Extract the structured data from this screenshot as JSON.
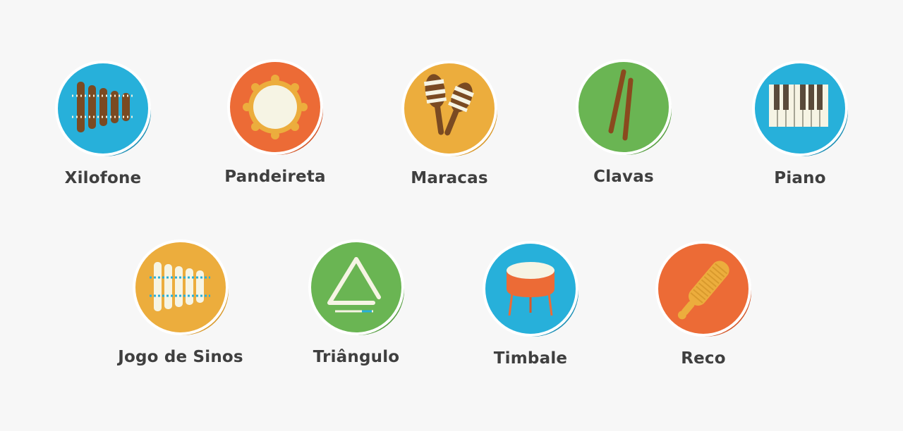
{
  "instruments": [
    {
      "id": "xilofone",
      "label": "Xilofone",
      "color": "#27b0da",
      "shadow": "#1d90b6",
      "icon": "xylophone-icon"
    },
    {
      "id": "pandeireta",
      "label": "Pandeireta",
      "color": "#ec6b36",
      "shadow": "#d4582a",
      "icon": "tambourine-icon"
    },
    {
      "id": "maracas",
      "label": "Maracas",
      "color": "#ecad3d",
      "shadow": "#d99a2d",
      "icon": "maracas-icon"
    },
    {
      "id": "clavas",
      "label": "Clavas",
      "color": "#6ab553",
      "shadow": "#58a043",
      "icon": "claves-icon"
    },
    {
      "id": "piano",
      "label": "Piano",
      "color": "#27b0da",
      "shadow": "#1d90b6",
      "icon": "piano-icon"
    },
    {
      "id": "jogo-de-sinos",
      "label": "Jogo de Sinos",
      "color": "#ecad3d",
      "shadow": "#d99a2d",
      "icon": "glockenspiel-icon"
    },
    {
      "id": "triangulo",
      "label": "Triângulo",
      "color": "#6ab553",
      "shadow": "#58a043",
      "icon": "triangle-icon"
    },
    {
      "id": "timbale",
      "label": "Timbale",
      "color": "#27b0da",
      "shadow": "#1d90b6",
      "icon": "timbale-icon"
    },
    {
      "id": "reco",
      "label": "Reco",
      "color": "#ec6b36",
      "shadow": "#d4582a",
      "icon": "guiro-icon"
    }
  ]
}
